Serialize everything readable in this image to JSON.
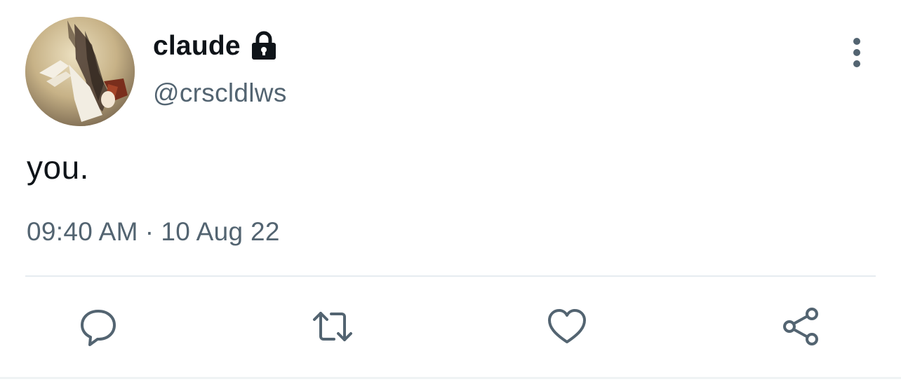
{
  "user": {
    "display_name": "claude",
    "handle": "@crscldlws",
    "protected": true
  },
  "tweet": {
    "text": "you.",
    "time": "09:40 AM",
    "separator": "·",
    "date": "10 Aug 22"
  },
  "actions": [
    {
      "name": "reply",
      "icon": "reply-icon"
    },
    {
      "name": "retweet",
      "icon": "retweet-icon"
    },
    {
      "name": "like",
      "icon": "heart-icon"
    },
    {
      "name": "share",
      "icon": "share-icon"
    }
  ],
  "colors": {
    "text_primary": "#0f1419",
    "text_secondary": "#536471",
    "icon": "#536471",
    "divider": "#e6ecf0"
  }
}
